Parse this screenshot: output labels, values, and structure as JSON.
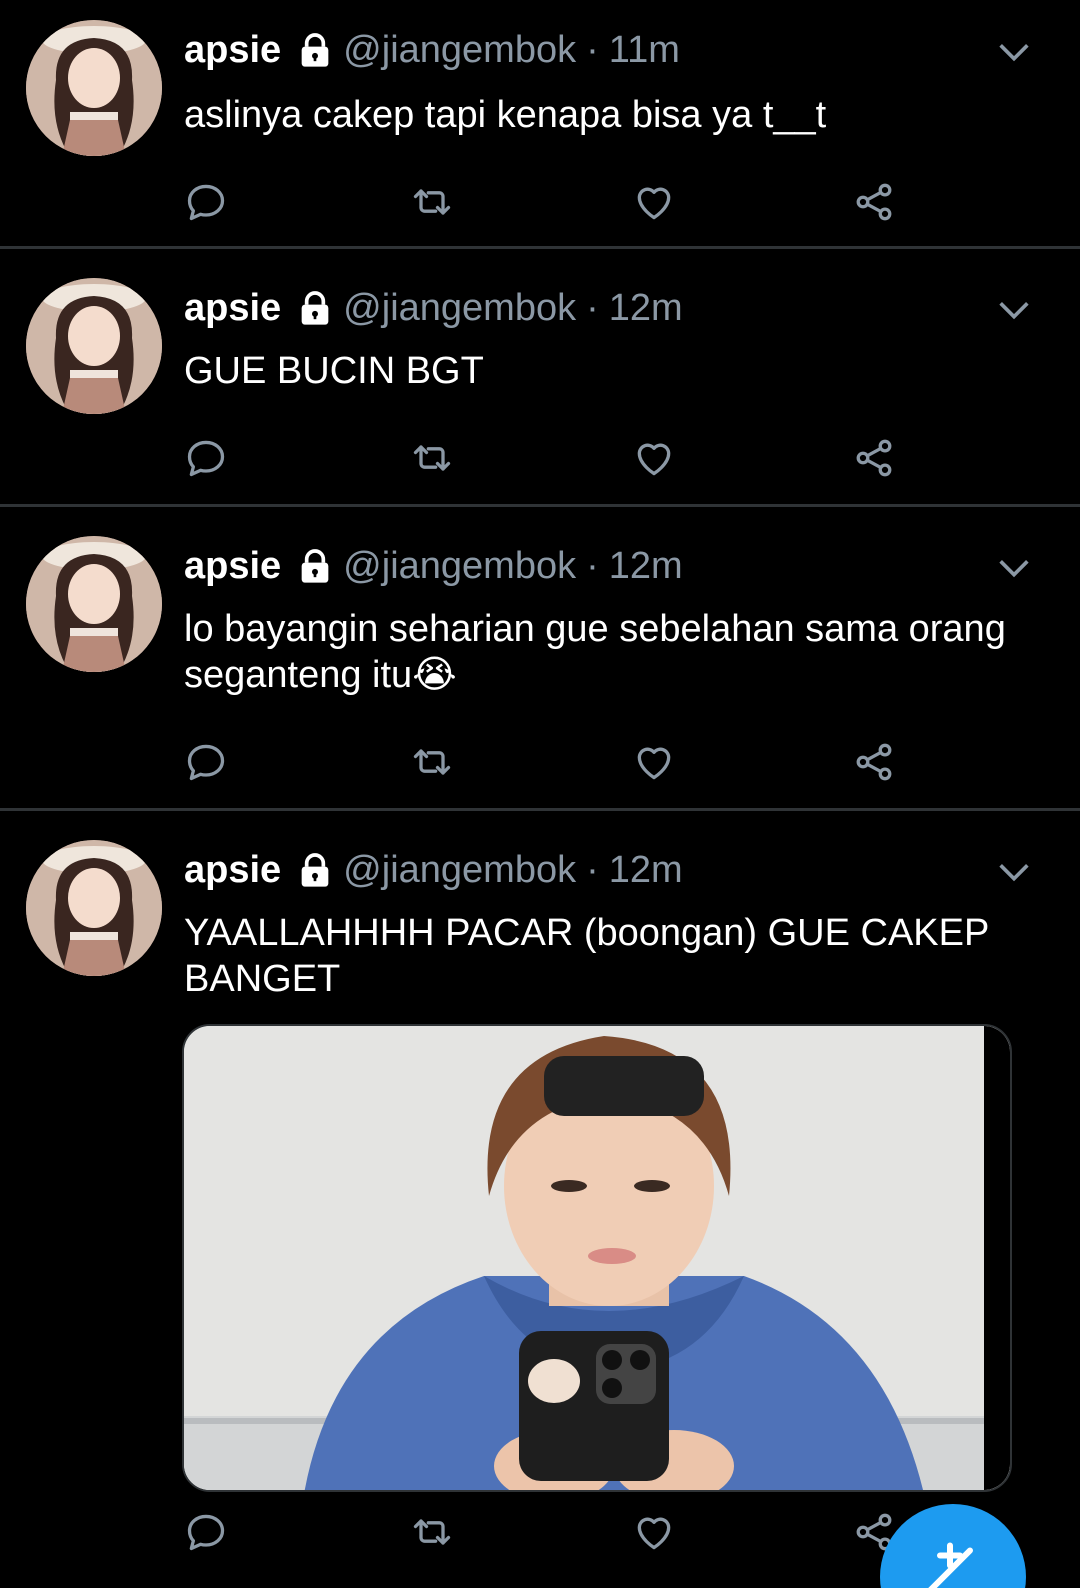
{
  "tweets": [
    {
      "name": "apsie",
      "handle": "@jiangembok",
      "sep": "·",
      "time": "11m",
      "text": "aslinya cakep tapi kenapa bisa ya t__t"
    },
    {
      "name": "apsie",
      "handle": "@jiangembok",
      "sep": "·",
      "time": "12m",
      "text": "GUE BUCIN BGT"
    },
    {
      "name": "apsie",
      "handle": "@jiangembok",
      "sep": "·",
      "time": "12m",
      "text_line1": "lo bayangin seharian gue sebelahan sama orang",
      "text_line2": "seganteng itu",
      "emoji": "😭"
    },
    {
      "name": "apsie",
      "handle": "@jiangembok",
      "sep": "·",
      "time": "12m",
      "text_line1": "YAALLAHHHH PACAR (boongan) GUE CAKEP",
      "text_line2": "BANGET"
    }
  ],
  "icons": {
    "reply": "reply-icon",
    "retweet": "retweet-icon",
    "like": "like-icon",
    "share": "share-icon",
    "lock": "lock-icon",
    "more": "chevron-down-icon",
    "compose": "compose-icon"
  },
  "colors": {
    "background": "#000000",
    "secondary_text": "#8b98a5",
    "divider": "#2f3336",
    "accent": "#1d9bf0"
  }
}
